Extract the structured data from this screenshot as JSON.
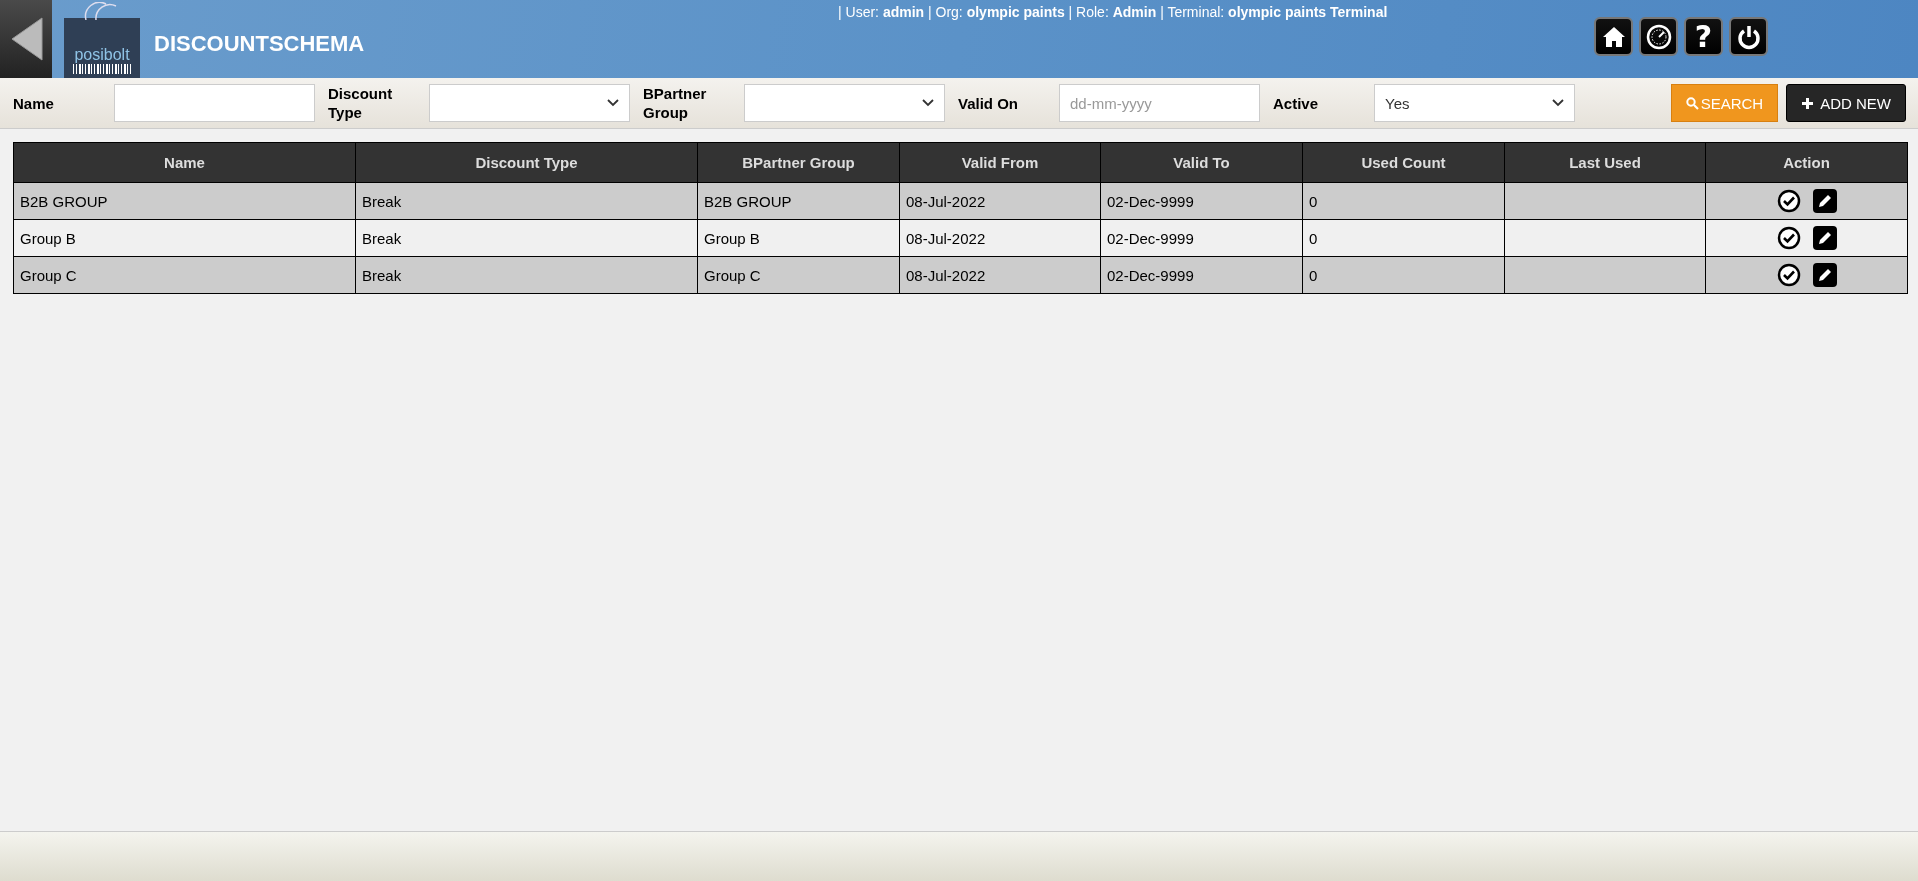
{
  "header": {
    "title": "DISCOUNTSCHEMA",
    "logo_text": "posibolt",
    "user_info": "| User: **admin** | Org: **olympic paints** | Role: **Admin** | Terminal: **olympic paints Terminal**",
    "help_glyph": "?"
  },
  "filters": [
    {
      "label": "Name",
      "kind": "text"
    },
    {
      "label": "Discount Type",
      "kind": "select"
    },
    {
      "label": "BPartner Group",
      "kind": "select"
    },
    {
      "label": "Valid On",
      "kind": "text",
      "placeholder": "dd-mm-yyyy"
    },
    {
      "label": "Active",
      "kind": "select",
      "value": "Yes"
    }
  ],
  "buttons": {
    "search": "SEARCH",
    "add_new": "ADD NEW"
  },
  "table": {
    "columns": [
      "Name",
      "Discount Type",
      "BPartner Group",
      "Valid From",
      "Valid To",
      "Used Count",
      "Last Used",
      "Action"
    ],
    "rows": [
      [
        "B2B GROUP",
        "Break",
        "B2B GROUP",
        "08-Jul-2022",
        "02-Dec-9999",
        "0",
        ""
      ],
      [
        "Group B",
        "Break",
        "Group B",
        "08-Jul-2022",
        "02-Dec-9999",
        "0",
        ""
      ],
      [
        "Group C",
        "Break",
        "Group C",
        "08-Jul-2022",
        "02-Dec-9999",
        "0",
        ""
      ]
    ]
  }
}
